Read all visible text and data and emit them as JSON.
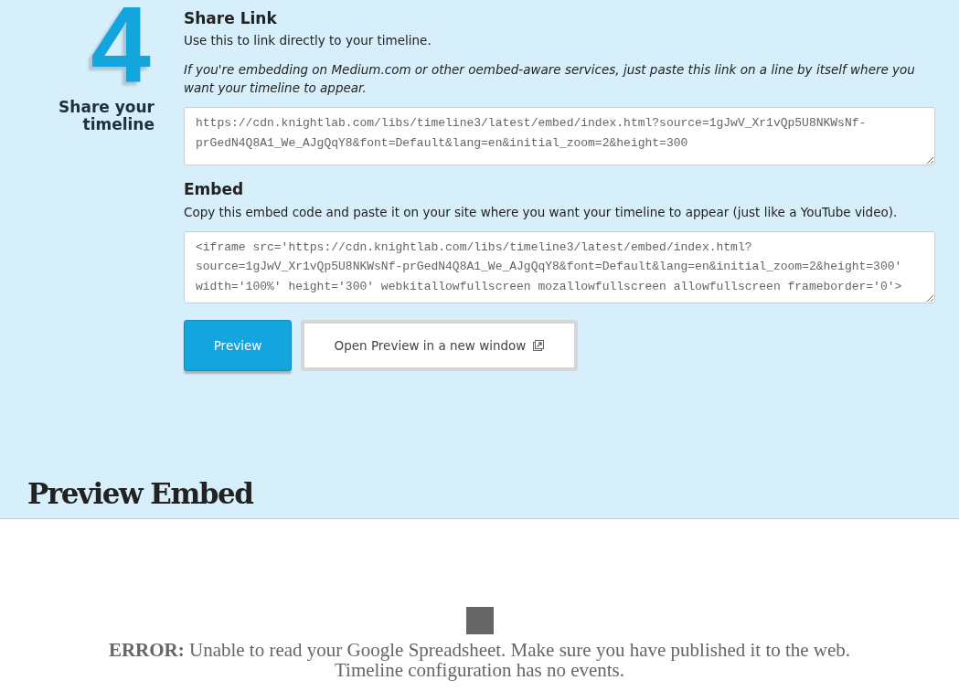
{
  "step": {
    "number": "4",
    "title": "Share your timeline"
  },
  "share_link": {
    "heading": "Share Link",
    "description": "Use this to link directly to your timeline.",
    "note": "If you're embedding on Medium.com or other oembed-aware services, just paste this link on a line by itself where you want your timeline to appear.",
    "value": "https://cdn.knightlab.com/libs/timeline3/latest/embed/index.html?source=1gJwV_Xr1vQp5U8NKWsNf-prGedN4Q8A1_We_AJgQqY8&font=Default&lang=en&initial_zoom=2&height=300"
  },
  "embed": {
    "heading": "Embed",
    "description": "Copy this embed code and paste it on your site where you want your timeline to appear (just like a YouTube video).",
    "value": "<iframe src='https://cdn.knightlab.com/libs/timeline3/latest/embed/index.html?source=1gJwV_Xr1vQp5U8NKWsNf-prGedN4Q8A1_We_AJgQqY8&font=Default&lang=en&initial_zoom=2&height=300' width='100%' height='300' webkitallowfullscreen mozallowfullscreen allowfullscreen frameborder='0'>"
  },
  "buttons": [
    {
      "label": "Preview",
      "kind": "primary"
    },
    {
      "label": "Open Preview in a new window",
      "kind": "external"
    }
  ],
  "preview": {
    "heading": "Preview Embed",
    "error": "**ERROR:** Unable to read your Google Spreadsheet. Make sure you have published it to the web.",
    "message": "Timeline configuration has no events."
  }
}
